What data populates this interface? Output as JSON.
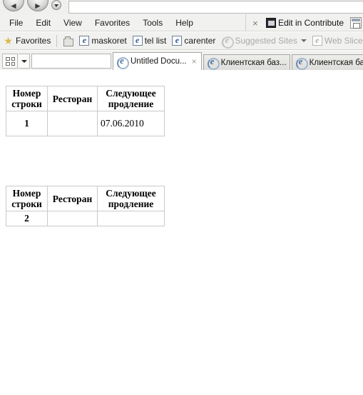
{
  "browser": {
    "nav": {
      "back_label": "◄",
      "forward_label": "►",
      "recent_pages_label": "▼"
    },
    "menu": {
      "items": [
        {
          "label": "File"
        },
        {
          "label": "Edit"
        },
        {
          "label": "View"
        },
        {
          "label": "Favorites"
        },
        {
          "label": "Tools"
        },
        {
          "label": "Help"
        }
      ],
      "close_label": "×",
      "contribute_label": "Edit in Contribute"
    },
    "favorites_bar": {
      "favorites_label": "Favorites",
      "items": [
        {
          "label": "maskoret",
          "dim": false
        },
        {
          "label": "tel list",
          "dim": false
        },
        {
          "label": "carenter",
          "dim": false
        },
        {
          "label": "Suggested Sites",
          "dim": true
        },
        {
          "label": "Web Slice Ga",
          "dim": true
        }
      ]
    },
    "tabs": {
      "quick_tabs_label": "Quick Tabs",
      "tab_list_label": "▼",
      "items": [
        {
          "label": "Untitled Docu...",
          "active": true,
          "close_label": "×"
        },
        {
          "label": "Клиентская баз...",
          "active": false
        },
        {
          "label": "Клиентская баз...",
          "active": false
        }
      ]
    }
  },
  "page": {
    "tables": [
      {
        "headers": {
          "row_number": "Номер строки",
          "restaurant": "Ресторан",
          "next_renewal": "Следующее продление"
        },
        "rows": [
          {
            "row_number": "1",
            "restaurant": "",
            "next_renewal": "07.06.2010"
          }
        ]
      },
      {
        "headers": {
          "row_number": "Номер строки",
          "restaurant": "Ресторан",
          "next_renewal": "Следующее продление"
        },
        "rows": [
          {
            "row_number": "2",
            "restaurant": "",
            "next_renewal": ""
          }
        ]
      }
    ]
  },
  "colors": {
    "chrome_bg": "#f1f1ef",
    "page_bg": "#ffffff",
    "table_border": "#c9c9c9",
    "text": "#000000",
    "dim_text": "#a9a9a7"
  }
}
